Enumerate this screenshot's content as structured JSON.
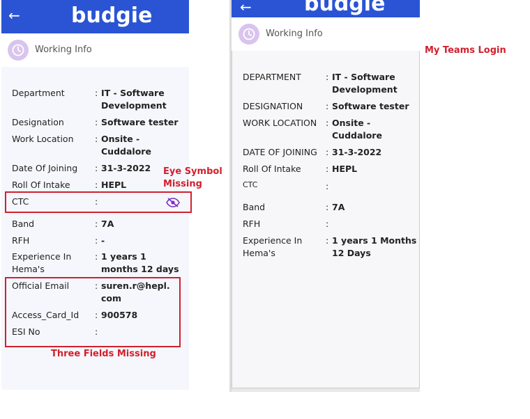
{
  "left": {
    "header": {
      "back_icon": "arrow-left-icon",
      "logo_text": "budgie"
    },
    "section": {
      "icon": "clock-icon",
      "title": "Working Info"
    },
    "fields": [
      {
        "label": "Department",
        "value": "IT - Software Development"
      },
      {
        "label": "Designation",
        "value": "Software tester"
      },
      {
        "label": "Work Location",
        "value": "Onsite - Cuddalore"
      },
      {
        "label": "Date Of Joining",
        "value": "31-3-2022"
      },
      {
        "label": "Roll Of Intake",
        "value": "HEPL"
      },
      {
        "label": "CTC",
        "value": ""
      },
      {
        "label": "Band",
        "value": "7A"
      },
      {
        "label": "RFH",
        "value": "-"
      },
      {
        "label": "Experience In Hema's",
        "value": "1 years 1 months 12 days"
      },
      {
        "label": "Official Email",
        "value": "suren.r@hepl.com"
      },
      {
        "label": "Access_Card_Id",
        "value": "900578"
      },
      {
        "label": "ESI No",
        "value": ""
      }
    ],
    "ctc_toggle_icon": "eye-off-icon"
  },
  "right": {
    "header": {
      "back_icon": "arrow-left-icon",
      "logo_text": "budgie"
    },
    "section": {
      "icon": "clock-icon",
      "title": "Working Info"
    },
    "fields": [
      {
        "label": "DEPARTMENT",
        "value": "IT - Software Development"
      },
      {
        "label": "DESIGNATION",
        "value": "Software tester"
      },
      {
        "label": "WORK LOCATION",
        "value": "Onsite - Cuddalore"
      },
      {
        "label": "DATE OF JOINING",
        "value": "31-3-2022"
      },
      {
        "label": "Roll Of Intake",
        "value": "HEPL"
      },
      {
        "label": "CTC",
        "value": ""
      },
      {
        "label": "Band",
        "value": "7A"
      },
      {
        "label": "RFH",
        "value": ""
      },
      {
        "label": "Experience In Hema's",
        "value": "1 years 1 Months 12 Days"
      }
    ]
  },
  "annotations": {
    "eye_missing": "Eye Symbol Missing",
    "three_fields": "Three Fields Missing",
    "teams_login": "My Teams Login"
  },
  "colors": {
    "header_blue": "#2a54d4",
    "annotation_red": "#d21f2d",
    "eye_purple": "#7a2fc0"
  }
}
